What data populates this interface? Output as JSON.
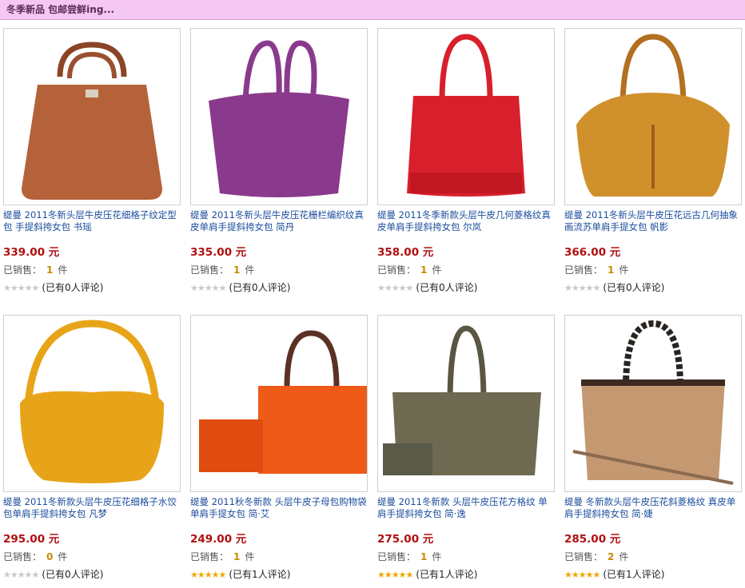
{
  "banner": {
    "text": "冬季新品 包邮尝鲜ing..."
  },
  "products": [
    {
      "title": "缇曼 2011冬新头层牛皮压花细格子纹定型包 手提斜挎女包 书瑶",
      "price": "339.00 元",
      "sold_label": "已销售：",
      "sold": "1",
      "unit": "件",
      "stars": 0,
      "reviews": "(已有0人评论)",
      "bag_color": "#b5623a",
      "image": "brown-tote-bag-icon"
    },
    {
      "title": "缇曼 2011冬新头层牛皮压花栅栏编织纹真皮单肩手提斜挎女包 简丹",
      "price": "335.00 元",
      "sold_label": "已销售：",
      "sold": "1",
      "unit": "件",
      "stars": 0,
      "reviews": "(已有0人评论)",
      "bag_color": "#8a3a8c",
      "image": "purple-tote-bag-icon"
    },
    {
      "title": "缇曼 2011冬季新款头层牛皮几何菱格纹真皮单肩手提斜挎女包 尔岚",
      "price": "358.00 元",
      "sold_label": "已销售：",
      "sold": "1",
      "unit": "件",
      "stars": 0,
      "reviews": "(已有0人评论)",
      "bag_color": "#d8202c",
      "image": "red-tote-bag-icon"
    },
    {
      "title": "缇曼 2011冬新头层牛皮压花远古几何抽象画流苏单肩手提女包 帆影",
      "price": "366.00 元",
      "sold_label": "已销售：",
      "sold": "1",
      "unit": "件",
      "stars": 0,
      "reviews": "(已有0人评论)",
      "bag_color": "#d0902c",
      "image": "tan-tote-bag-icon"
    },
    {
      "title": "缇曼 2011冬新款头层牛皮压花细格子水饺包单肩手提斜挎女包 凡梦",
      "price": "295.00 元",
      "sold_label": "已销售：",
      "sold": "0",
      "unit": "件",
      "stars": 0,
      "reviews": "(已有0人评论)",
      "bag_color": "#e8a418",
      "image": "yellow-hobo-bag-icon"
    },
    {
      "title": "缇曼 2011秋冬新款 头层牛皮子母包购物袋 单肩手提女包 简·艾",
      "price": "249.00 元",
      "sold_label": "已销售：",
      "sold": "1",
      "unit": "件",
      "stars": 5,
      "reviews": "(已有1人评论)",
      "bag_color": "#ee5a18",
      "image": "orange-shopper-bag-icon"
    },
    {
      "title": "缇曼 2011冬新款 头层牛皮压花方格纹 单肩手提斜挎女包 简·逸",
      "price": "275.00 元",
      "sold_label": "已销售：",
      "sold": "1",
      "unit": "件",
      "stars": 5,
      "reviews": "(已有1人评论)",
      "bag_color": "#6e6a52",
      "image": "olive-tote-bag-icon"
    },
    {
      "title": "缇曼 冬新款头层牛皮压花斜菱格纹 真皮单肩手提斜挎女包 简·婕",
      "price": "285.00 元",
      "sold_label": "已销售：",
      "sold": "2",
      "unit": "件",
      "stars": 5,
      "reviews": "(已有1人评论)",
      "bag_color": "#c49870",
      "image": "beige-tote-bag-icon"
    }
  ]
}
